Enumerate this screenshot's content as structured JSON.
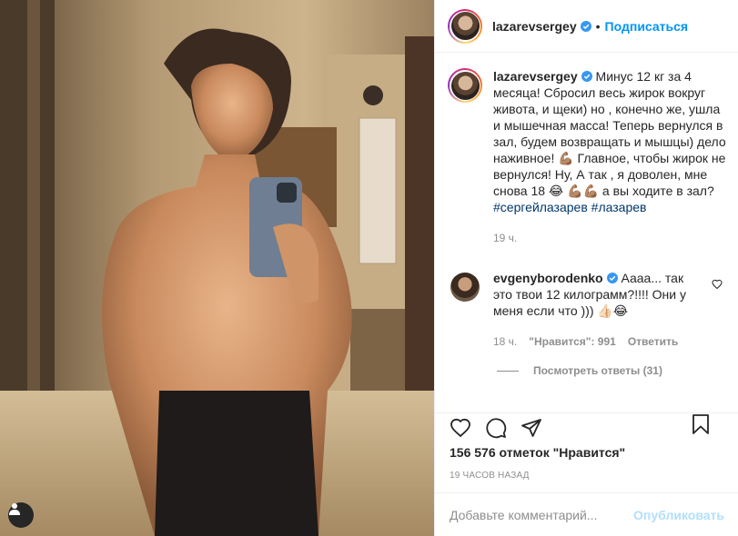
{
  "post": {
    "username": "lazarevsergey",
    "follow_label": "Подписаться",
    "header_separator": "•",
    "caption": "Минус 12 кг за 4 месяца! Сбросил весь жирок вокруг живота, и щеки) но , конечно же, ушла и мышечная масса! Теперь вернулся в зал, будем возвращать и мышцы) дело наживное! 💪🏽 Главное, чтобы жирок не вернулся! Ну, А так , я доволен, мне снова 18 😂 💪🏽💪🏽 а вы ходите в зал?",
    "hashtags": "#сергейлазарев #лазарев",
    "caption_time": "19 ч."
  },
  "comment": {
    "username": "evgenyborodenko",
    "text": "Аааа... так это твои 12 килограмм?!!!! Они у меня если что ))) 👍🏻😂",
    "time": "18 ч.",
    "likes": "\"Нравится\": 991",
    "reply_label": "Ответить",
    "view_replies": "Посмотреть ответы (31)"
  },
  "actions": {
    "icons": [
      "heart-icon",
      "comment-icon",
      "share-icon",
      "bookmark-icon"
    ],
    "likes_count": "156 576 отметок \"Нравится\"",
    "posted_ago": "19 ЧАСОВ НАЗАД"
  },
  "add_comment": {
    "placeholder": "Добавьте комментарий...",
    "publish_label": "Опубликовать"
  },
  "colors": {
    "link": "#0095f6",
    "hashtag": "#00376b",
    "muted": "#8e8e8e",
    "publish_disabled": "#b2dffc"
  }
}
